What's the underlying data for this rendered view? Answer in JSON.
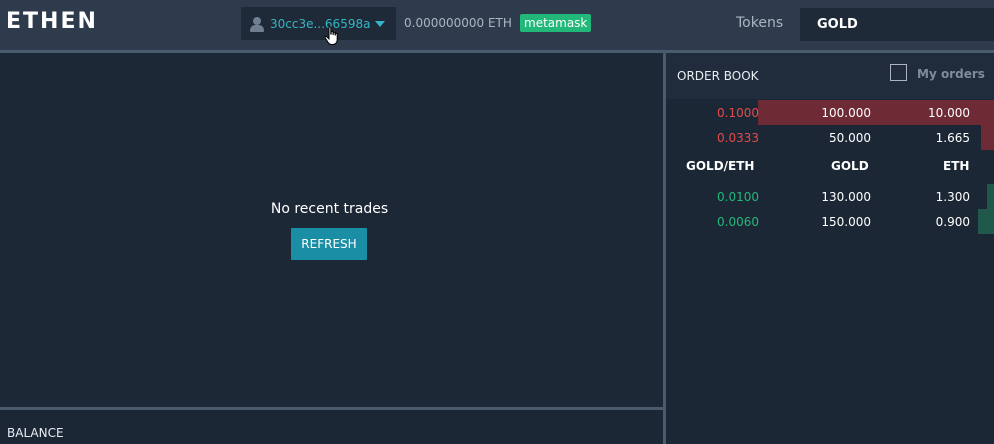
{
  "header": {
    "logo": "ETHEN",
    "account_address": "30cc3e...66598a",
    "eth_balance": "0.000000000 ETH",
    "wallet_badge": "metamask",
    "tokens_label": "Tokens",
    "selected_token": "GOLD"
  },
  "trades": {
    "empty_message": "No recent trades",
    "refresh_label": "REFRESH"
  },
  "balance": {
    "title": "BALANCE"
  },
  "orderbook": {
    "title": "ORDER BOOK",
    "my_orders_label": "My orders",
    "my_orders_checked": false,
    "columns": [
      "GOLD/ETH",
      "GOLD",
      "ETH"
    ],
    "sells": [
      {
        "price": "0.1000",
        "amount": "100.000",
        "total": "10.000",
        "depth": 0.72
      },
      {
        "price": "0.0333",
        "amount": "50.000",
        "total": "1.665",
        "depth": 0.04
      }
    ],
    "buys": [
      {
        "price": "0.0100",
        "amount": "130.000",
        "total": "1.300",
        "depth": 0.02
      },
      {
        "price": "0.0060",
        "amount": "150.000",
        "total": "0.900",
        "depth": 0.05
      }
    ],
    "colors": {
      "sell": "#e14b4b",
      "buy": "#22b879",
      "sell_bar": "#6e2b36",
      "buy_bar": "#20594b"
    }
  }
}
